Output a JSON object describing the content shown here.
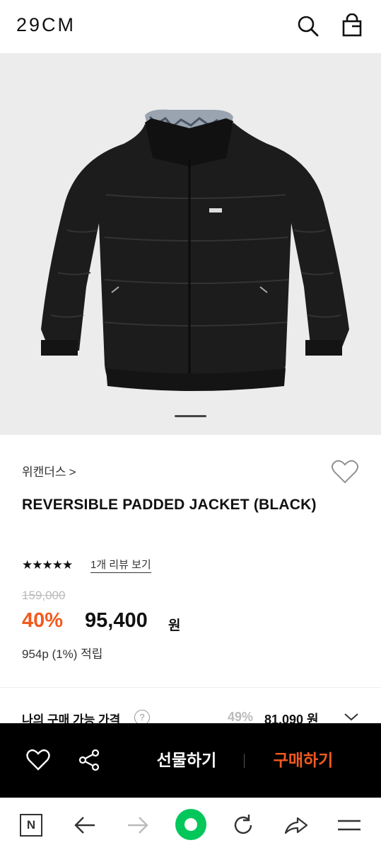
{
  "header": {
    "logo": "29CM",
    "icons": [
      "search-icon",
      "shopping-bag-icon"
    ]
  },
  "gallery": {
    "image_subject": "black reversible padded jacket",
    "page_indicator": "slide 1"
  },
  "product": {
    "brand": "위캔더스",
    "brand_chevron": ">",
    "title": "REVERSIBLE PADDED JACKET (BLACK)",
    "stars": "★★★★★",
    "rating": 5,
    "review_link": "1개 리뷰 보기",
    "original_price": "159,000",
    "discount": "40%",
    "sale_price": "95,400",
    "currency": "원",
    "points": "954p (1%) 적립"
  },
  "my_purchase": {
    "label": "나의 구매 가능 가격",
    "help": "?",
    "discount": "49%",
    "price": "81,090 원"
  },
  "action_bar": {
    "gift_label": "선물하기",
    "buy_label": "구매하기",
    "buy_color": "#f25a1e"
  },
  "browser_bar": {
    "n_label": "N",
    "home_color": "#03c75a"
  }
}
